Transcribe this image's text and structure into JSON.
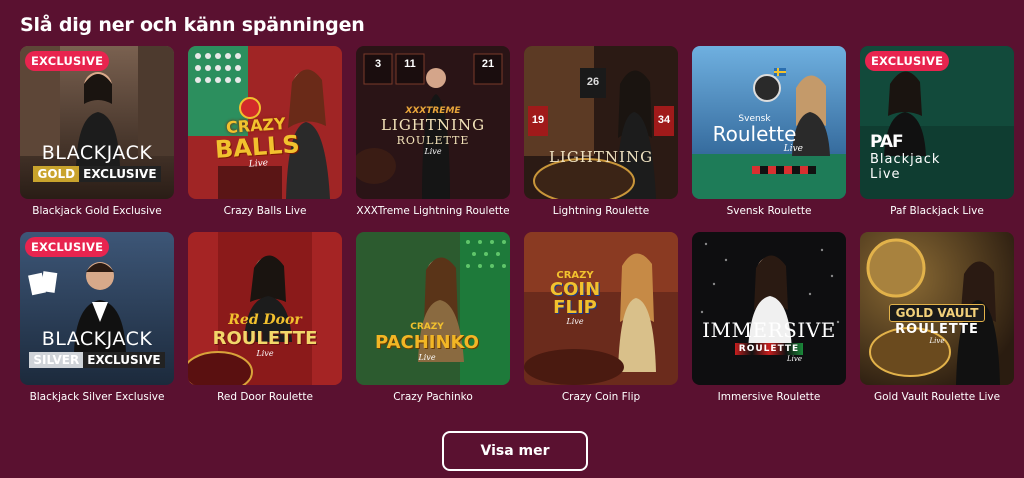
{
  "section": {
    "title": "Slå dig ner och känn spänningen"
  },
  "games": [
    {
      "label": "Blackjack Gold Exclusive",
      "badge": "EXCLUSIVE",
      "art_line1": "BLACKJACK",
      "art_line2a": "GOLD",
      "art_line2b": "EXCLUSIVE",
      "bg": "#6b5344",
      "accent": "#c9a32d"
    },
    {
      "label": "Crazy Balls Live",
      "art_line1": "CRAZY",
      "art_line2": "BALLS",
      "art_line3": "Live",
      "bg": "#b22d2a",
      "accent": "#f2c12e"
    },
    {
      "label": "XXXTreme Lightning Roulette",
      "art_line1": "XXXTREME",
      "art_line2": "LIGHTNING",
      "art_line3": "ROULETTE",
      "art_line4": "Live",
      "art_num1": "3",
      "art_num2": "11",
      "art_num3": "21",
      "bg": "#2a1416",
      "accent": "#e8a53a"
    },
    {
      "label": "Lightning Roulette",
      "art_line1": "LIGHTNING",
      "art_num1": "26",
      "art_num2": "19",
      "art_num3": "34",
      "bg": "#2b1a14",
      "accent": "#d9a94b"
    },
    {
      "label": "Svensk Roulette",
      "art_line1": "Svensk",
      "art_line2": "Roulette",
      "art_line3": "Live",
      "bg": "#2c6fae",
      "accent": "#1e7c58"
    },
    {
      "label": "Paf Blackjack Live",
      "badge": "EXCLUSIVE",
      "art_line1": "PAF",
      "art_line2": "Blackjack",
      "art_line3": "Live",
      "bg": "#0f3d31",
      "accent": "#1c5a47"
    },
    {
      "label": "Blackjack Silver Exclusive",
      "badge": "EXCLUSIVE",
      "art_line1": "BLACKJACK",
      "art_line2a": "SILVER",
      "art_line2b": "EXCLUSIVE",
      "bg": "#2b3e5c",
      "accent": "#cfd3d8"
    },
    {
      "label": "Red Door Roulette",
      "art_line1": "Red Door",
      "art_line2": "ROULETTE",
      "art_line3": "Live",
      "bg": "#8b1a1a",
      "accent": "#e8b33a"
    },
    {
      "label": "Crazy Pachinko",
      "art_line1": "CRAZY",
      "art_line2": "PACHINKO",
      "art_line3": "Live",
      "bg": "#2c5b2f",
      "accent": "#f2b625"
    },
    {
      "label": "Crazy Coin Flip",
      "art_line1": "CRAZY",
      "art_line2": "COIN",
      "art_line3": "FLIP",
      "art_line4": "Live",
      "bg": "#6b2b1c",
      "accent": "#f2c12e"
    },
    {
      "label": "Immersive Roulette",
      "art_line1": "IMMERSIVE",
      "art_line2": "ROULETTE",
      "art_line3": "Live",
      "bg": "#0e0e10",
      "accent": "#d9d9d9"
    },
    {
      "label": "Gold Vault Roulette Live",
      "art_line1": "GOLD VAULT",
      "art_line2": "ROULETTE",
      "art_line3": "Live",
      "bg": "#3a2a18",
      "accent": "#e2b24a"
    }
  ],
  "actions": {
    "show_more": "Visa mer"
  }
}
